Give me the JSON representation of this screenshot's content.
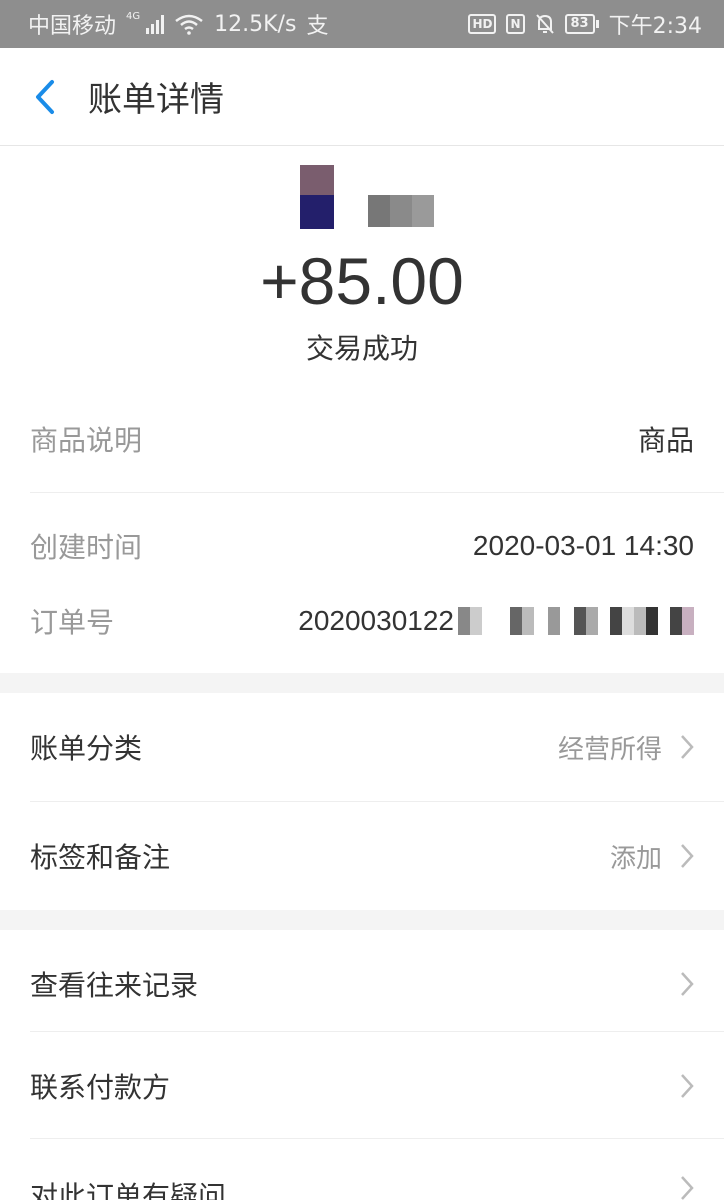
{
  "status_bar": {
    "carrier": "中国移动",
    "network_tag": "4G",
    "speed": "12.5K/s",
    "app_glyph": "支",
    "hd": "HD",
    "nfc": "N",
    "battery": "83",
    "time": "下午2:34",
    "icons": [
      "signal-icon",
      "wifi-icon",
      "alipay-notify-icon",
      "hd-icon",
      "nfc-icon",
      "mute-bell-icon",
      "battery-icon"
    ]
  },
  "header": {
    "title": "账单详情",
    "back_icon": "chevron-left-icon"
  },
  "summary": {
    "amount": "+85.00",
    "status": "交易成功"
  },
  "info": {
    "product": {
      "label": "商品说明",
      "value": "商品"
    },
    "created": {
      "label": "创建时间",
      "value": "2020-03-01 14:30"
    },
    "order": {
      "label": "订单号",
      "value_prefix": "2020030122"
    }
  },
  "menu": {
    "category": {
      "label": "账单分类",
      "value": "经营所得"
    },
    "tags": {
      "label": "标签和备注",
      "value": "添加"
    },
    "history": {
      "label": "查看往来记录"
    },
    "contact": {
      "label": "联系付款方"
    },
    "question": {
      "label": "对此订单有疑问"
    }
  },
  "colors": {
    "accent": "#1a8ce8",
    "status_bar_bg": "#8e8e8e",
    "label_gray": "#999999",
    "text": "#333333",
    "gap_band": "#f4f4f4"
  }
}
